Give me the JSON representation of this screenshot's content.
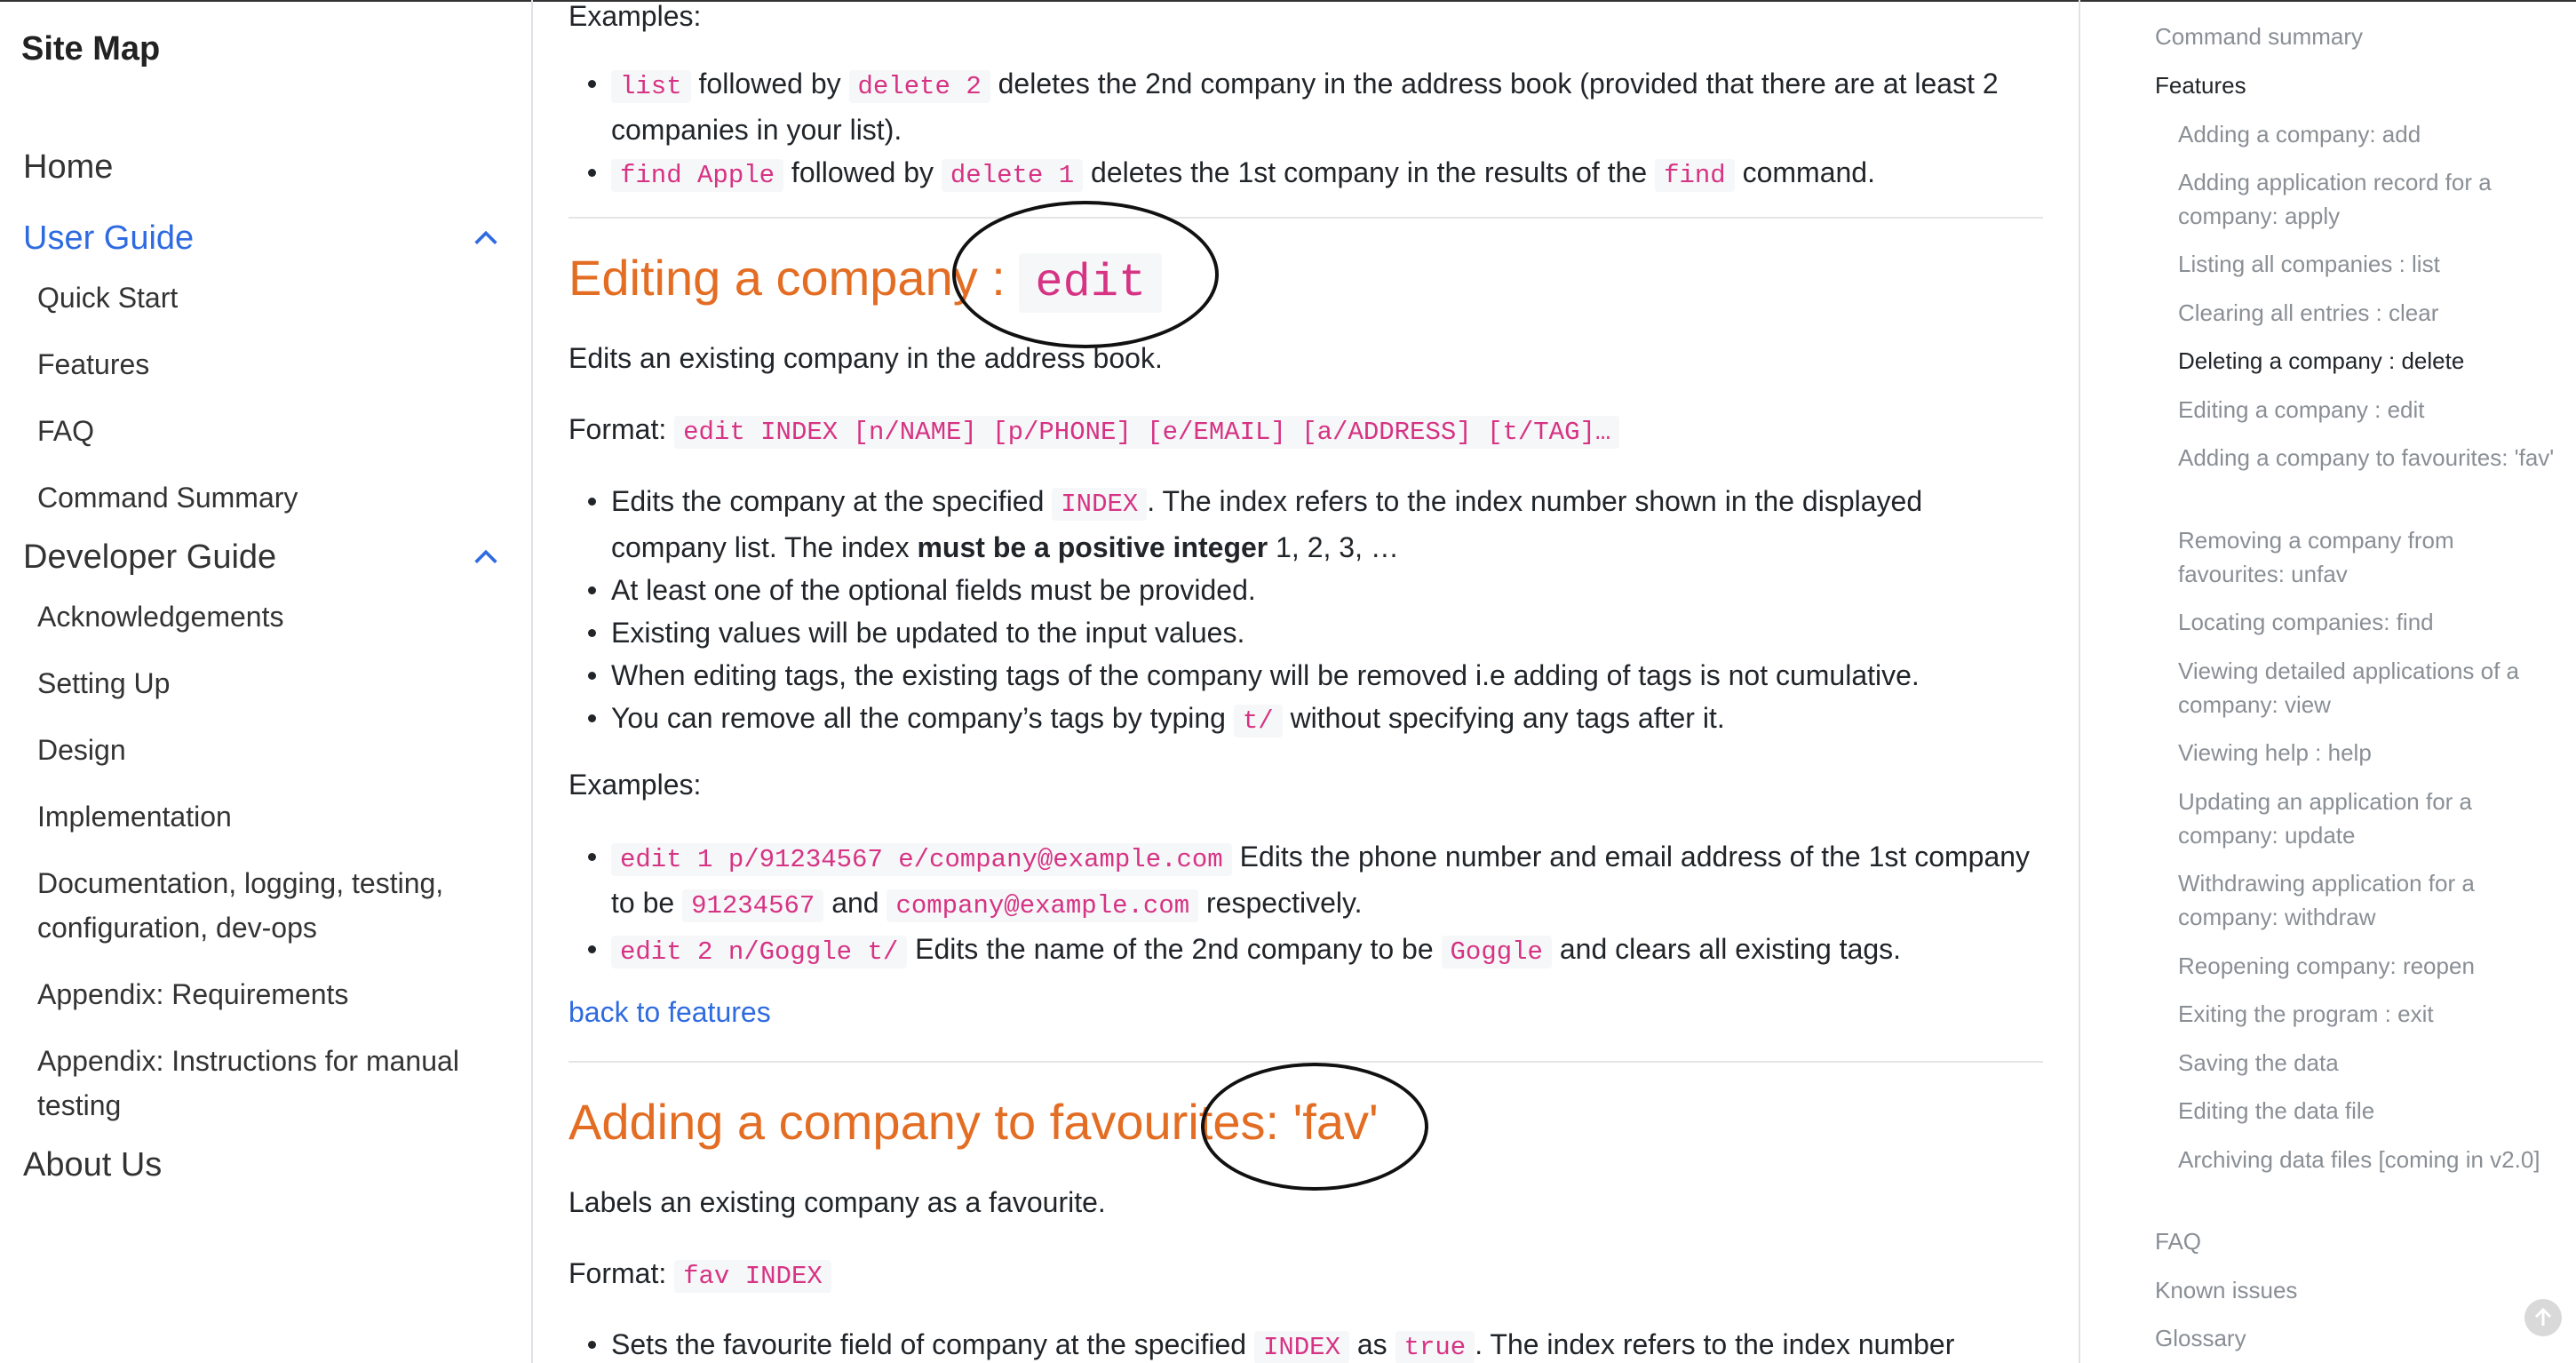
{
  "sidebar": {
    "title": "Site Map",
    "home": "Home",
    "user_guide": {
      "label": "User Guide",
      "items": [
        "Quick Start",
        "Features",
        "FAQ",
        "Command Summary"
      ]
    },
    "developer_guide": {
      "label": "Developer Guide",
      "items": [
        "Acknowledgements",
        "Setting Up",
        "Design",
        "Implementation",
        "Documentation, logging, testing, configuration, dev-ops",
        "Appendix: Requirements",
        "Appendix: Instructions for manual testing"
      ]
    },
    "about": "About Us"
  },
  "content": {
    "examples_top_label": "Examples:",
    "delete_examples": [
      {
        "code1": "list",
        "t1": "followed by",
        "code2": "delete 2",
        "t2": "deletes the 2nd company in the address book (provided that there are at least 2 companies in your list)."
      },
      {
        "code1": "find Apple",
        "t1": "followed by",
        "code2": "delete 1",
        "t2": "deletes the 1st company in the results of the",
        "code3": "find",
        "t3": "command."
      }
    ],
    "edit": {
      "heading_text": "Editing a company :",
      "heading_code": "edit",
      "description": "Edits an existing company in the address book.",
      "format_label": "Format:",
      "format_code": "edit INDEX [n/NAME] [p/PHONE] [e/EMAIL] [a/ADDRESS] [t/TAG]…",
      "bullet1_pre": "Edits the company at the specified",
      "bullet1_code": "INDEX",
      "bullet1_post": ". The index refers to the index number shown in the displayed company list. The index",
      "bullet1_bold": "must be a positive integer",
      "bullet1_end": "1, 2, 3, …",
      "bullet2": "At least one of the optional fields must be provided.",
      "bullet3": "Existing values will be updated to the input values.",
      "bullet4": "When editing tags, the existing tags of the company will be removed i.e adding of tags is not cumulative.",
      "bullet5_pre": "You can remove all the company’s tags by typing",
      "bullet5_code": "t/",
      "bullet5_post": "without specifying any tags after it.",
      "examples_label": "Examples:",
      "ex1_code": "edit 1 p/91234567 e/company@example.com",
      "ex1_text": "Edits the phone number and email address of the 1st company to be",
      "ex1_code2": "91234567",
      "ex1_and": "and",
      "ex1_code3": "company@example.com",
      "ex1_end": "respectively.",
      "ex2_code": "edit 2 n/Goggle t/",
      "ex2_text": "Edits the name of the 2nd company to be",
      "ex2_code2": "Goggle",
      "ex2_end": "and clears all existing tags.",
      "back_link": "back to features"
    },
    "fav": {
      "heading": "Adding a company to favourites: 'fav'",
      "description": "Labels an existing company as a favourite.",
      "format_label": "Format:",
      "format_code": "fav INDEX",
      "bullet1_pre": "Sets the favourite field of company at the specified",
      "bullet1_code": "INDEX",
      "bullet1_as": "as",
      "bullet1_code2": "true",
      "bullet1_post": ". The index refers to the index number"
    }
  },
  "toc": {
    "items": [
      {
        "label": "Command summary",
        "level": 1
      },
      {
        "label": "Features",
        "level": 1,
        "dark": true
      },
      {
        "label": "Adding a company: add",
        "level": 2
      },
      {
        "label": "Adding application record for a company: apply",
        "level": 2
      },
      {
        "label": "Listing all companies : list",
        "level": 2
      },
      {
        "label": "Clearing all entries : clear",
        "level": 2
      },
      {
        "label": "Deleting a company : delete",
        "level": 2,
        "dark": true
      },
      {
        "label": "Editing a company : edit",
        "level": 2
      },
      {
        "label": "Adding a company to favourites: 'fav'",
        "level": 2
      },
      {
        "label": "Removing a company from favourites: unfav",
        "level": 2
      },
      {
        "label": "Locating companies: find",
        "level": 2
      },
      {
        "label": "Viewing detailed applications of a company: view",
        "level": 2
      },
      {
        "label": "Viewing help : help",
        "level": 2
      },
      {
        "label": "Updating an application for a company: update",
        "level": 2
      },
      {
        "label": "Withdrawing application for a company: withdraw",
        "level": 2
      },
      {
        "label": "Reopening company: reopen",
        "level": 2
      },
      {
        "label": "Exiting the program : exit",
        "level": 2
      },
      {
        "label": "Saving the data",
        "level": 2
      },
      {
        "label": "Editing the data file",
        "level": 2
      },
      {
        "label": "Archiving data files [coming in v2.0]",
        "level": 2
      },
      {
        "label": "FAQ",
        "level": 1
      },
      {
        "label": "Known issues",
        "level": 1
      },
      {
        "label": "Glossary",
        "level": 1
      }
    ]
  }
}
